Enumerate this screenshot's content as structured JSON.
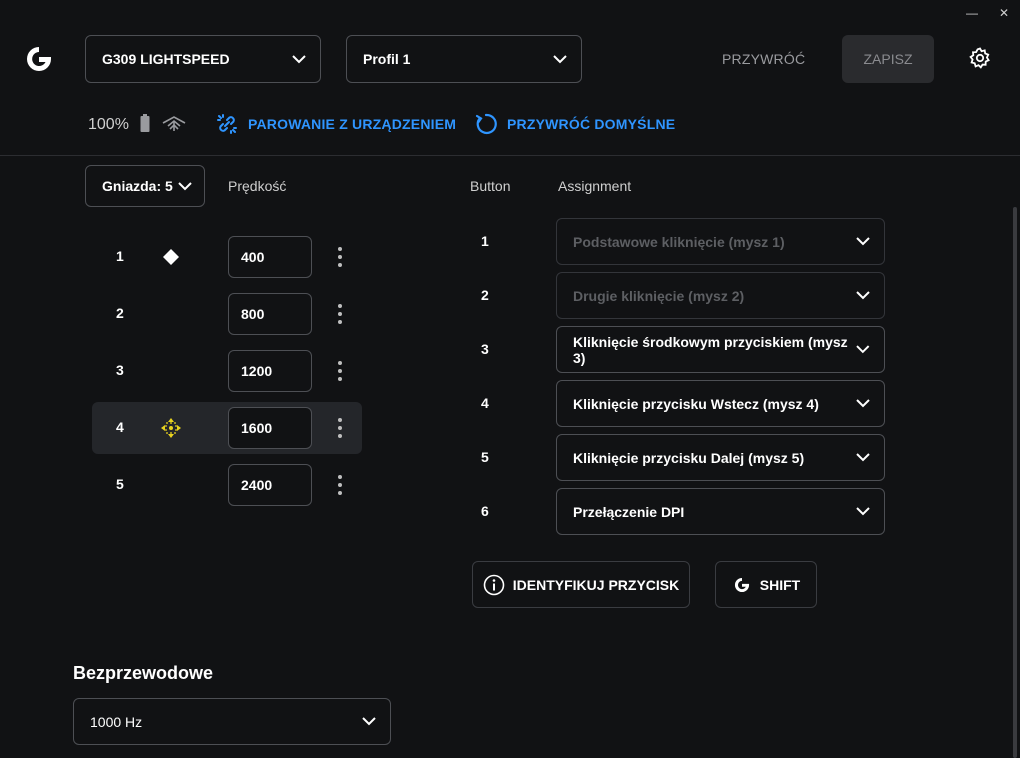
{
  "window": {
    "minimize_glyph": "—",
    "close_glyph": "✕"
  },
  "header": {
    "device_select": "G309 LIGHTSPEED",
    "profile_select": "Profil 1",
    "restore_label": "PRZYWRÓĆ",
    "save_label": "ZAPISZ"
  },
  "status": {
    "battery": "100%",
    "pairing_label": "PAROWANIE Z URZĄDZENIEM",
    "restore_defaults_label": "PRZYWRÓĆ DOMYŚLNE"
  },
  "dpi": {
    "slots_select": "Gniazda: 5",
    "speed_header": "Prędkość",
    "rows": [
      {
        "num": "1",
        "value": "400"
      },
      {
        "num": "2",
        "value": "800"
      },
      {
        "num": "3",
        "value": "1200"
      },
      {
        "num": "4",
        "value": "1600"
      },
      {
        "num": "5",
        "value": "2400"
      }
    ]
  },
  "assignments": {
    "button_header": "Button",
    "assignment_header": "Assignment",
    "rows": [
      {
        "num": "1",
        "value": "Podstawowe kliknięcie (mysz 1)"
      },
      {
        "num": "2",
        "value": "Drugie kliknięcie (mysz 2)"
      },
      {
        "num": "3",
        "value": "Kliknięcie środkowym przyciskiem (mysz 3)"
      },
      {
        "num": "4",
        "value": "Kliknięcie przycisku Wstecz (mysz 4)"
      },
      {
        "num": "5",
        "value": "Kliknięcie przycisku Dalej (mysz 5)"
      },
      {
        "num": "6",
        "value": "Przełączenie DPI"
      }
    ],
    "identify_label": "IDENTYFIKUJ PRZYCISK",
    "shift_label": "SHIFT"
  },
  "wireless": {
    "title": "Bezprzewodowe",
    "rate_select": "1000 Hz"
  },
  "colors": {
    "accent_blue": "#2f95ff",
    "default_marker": "#ffffff",
    "shift_marker": "#e8d21f"
  }
}
